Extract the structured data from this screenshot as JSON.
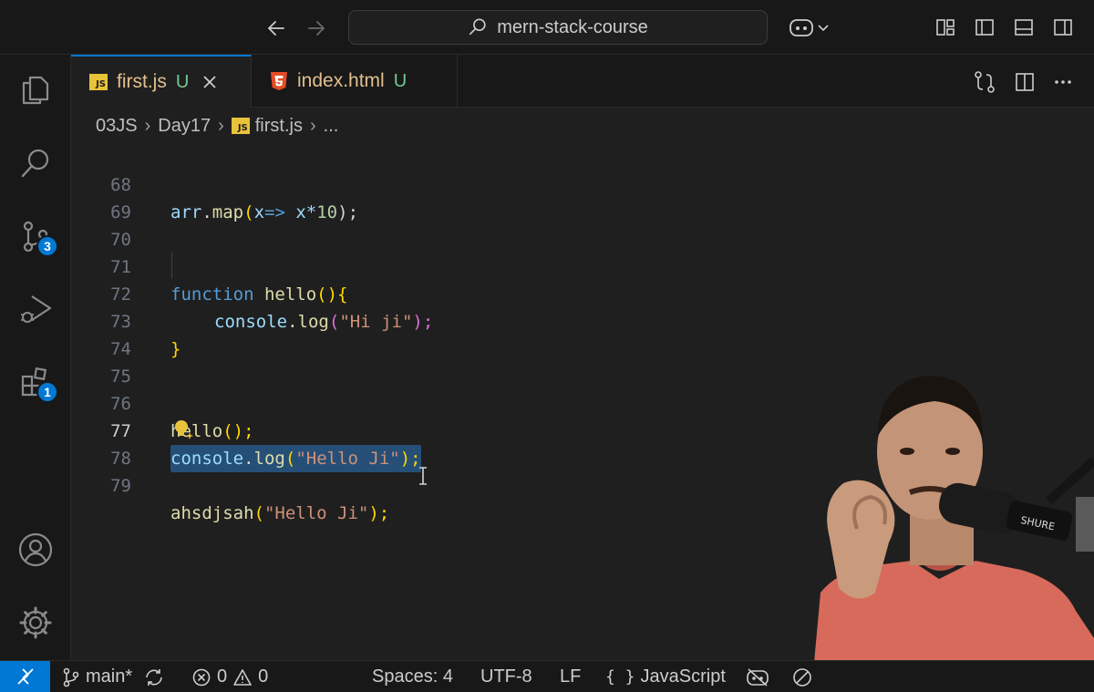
{
  "titlebar": {
    "search_label": "mern-stack-course"
  },
  "activity": {
    "source_control_badge": "3",
    "extensions_badge": "1"
  },
  "tabs": [
    {
      "label": "first.js",
      "status": "U",
      "icon": "js-file-icon",
      "active": true
    },
    {
      "label": "index.html",
      "status": "U",
      "icon": "html5-file-icon",
      "active": false
    }
  ],
  "breadcrumb": {
    "parts": [
      "03JS",
      "Day17",
      "first.js",
      "..."
    ]
  },
  "editor": {
    "line_numbers": [
      "68",
      "69",
      "70",
      "71",
      "72",
      "73",
      "74",
      "75",
      "76",
      "77",
      "78",
      "79"
    ],
    "current_line": "77",
    "lines": {
      "l68": {
        "a": "arr",
        "b": ".",
        "c": "map",
        "d": "(",
        "e": "x",
        "f": "=>",
        "g": " x*",
        "h": "10",
        "i": ");"
      },
      "l71": {
        "a": "function",
        "b": " hello",
        "c": "()",
        "d": "{"
      },
      "l72": {
        "a": "console",
        "b": ".",
        "c": "log",
        "d": "(",
        "e": "\"Hi ji\"",
        "f": ");"
      },
      "l73": {
        "a": "}"
      },
      "l76": {
        "a": "hello",
        "b": "();"
      },
      "l77": {
        "a": "console",
        "b": ".",
        "c": "log",
        "d": "(",
        "e": "\"Hello Ji\"",
        "f": ");"
      },
      "l79": {
        "a": "ahsdjsah",
        "b": "(",
        "c": "\"Hello Ji\"",
        "d": ");"
      }
    }
  },
  "statusbar": {
    "branch": "main*",
    "errors": "0",
    "warnings": "0",
    "spaces": "Spaces: 4",
    "encoding": "UTF-8",
    "eol": "LF",
    "language": "JavaScript"
  },
  "colors": {
    "accent": "#0078d4",
    "untracked": "#73c991",
    "js_badge": "#e8c33a",
    "html_badge": "#e44d26"
  }
}
